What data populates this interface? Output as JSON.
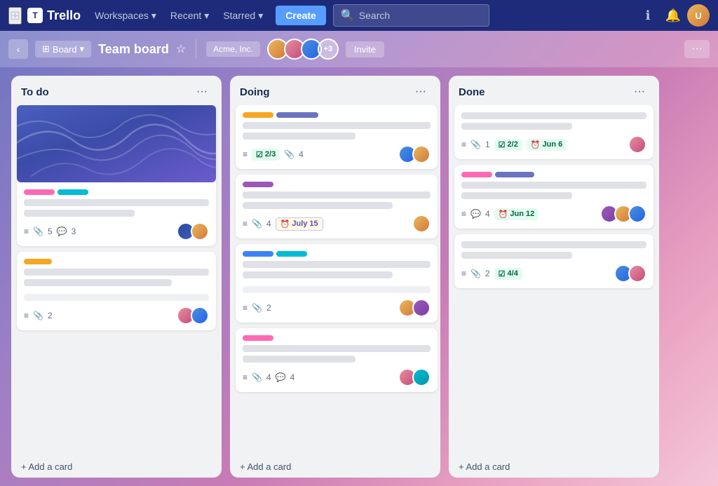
{
  "app": {
    "name": "Trello",
    "logo_char": "T"
  },
  "topnav": {
    "workspaces": "Workspaces",
    "recent": "Recent",
    "starred": "Starred",
    "create": "Create",
    "search_placeholder": "Search",
    "info_icon": "ℹ",
    "bell_icon": "🔔"
  },
  "board_header": {
    "view_label": "Board",
    "title": "Team board",
    "workspace": "Acme, Inc.",
    "extra_members": "+3",
    "invite": "Invite",
    "more": "···",
    "sidebar_arrow": "‹"
  },
  "columns": [
    {
      "id": "todo",
      "title": "To do",
      "cards": [
        {
          "id": "c1",
          "has_cover": true,
          "labels": [
            "#FF69B4",
            "#00BCD4"
          ],
          "title_lines": [
            "full",
            "short"
          ],
          "meta": {
            "list": true,
            "clips": "5",
            "comments": "3"
          },
          "avatars": [
            "#4A90D9",
            "#E8B95A"
          ]
        },
        {
          "id": "c2",
          "has_cover": false,
          "labels": [
            "#F5A623"
          ],
          "title_lines": [
            "full",
            "med"
          ],
          "meta": {
            "list": true,
            "clips": "2"
          },
          "avatars": [
            "#E88DA0",
            "#4A90D9"
          ]
        }
      ],
      "add_label": "+ Add a card"
    },
    {
      "id": "doing",
      "title": "Doing",
      "cards": [
        {
          "id": "d1",
          "has_cover": false,
          "labels": [
            "#F5A623",
            "#6B73C1"
          ],
          "title_lines": [
            "full",
            "short"
          ],
          "meta": {
            "list": true,
            "checks": "2/3",
            "clips": "4"
          },
          "avatars": [
            "#4A90D9",
            "#E8B95A"
          ]
        },
        {
          "id": "d2",
          "has_cover": false,
          "labels": [
            "#9B59B6"
          ],
          "title_lines": [
            "full",
            "med"
          ],
          "meta": {
            "list": true,
            "clips": "4",
            "date": "July 15"
          },
          "avatars": [
            "#E8B95A"
          ]
        },
        {
          "id": "d3",
          "has_cover": false,
          "labels": [
            "#3B82F6",
            "#00BCD4"
          ],
          "title_lines": [
            "full",
            "med"
          ],
          "meta": {
            "list": true,
            "clips": "2"
          },
          "avatars": [
            "#E8B95A",
            "#9B59B6"
          ]
        },
        {
          "id": "d4",
          "has_cover": false,
          "labels": [
            "#FF69B4"
          ],
          "title_lines": [
            "full",
            "short"
          ],
          "meta": {
            "list": true,
            "clips": "4",
            "comments": "4"
          },
          "avatars": [
            "#E88DA0",
            "#00BCD4"
          ]
        }
      ],
      "add_label": "+ Add a card"
    },
    {
      "id": "done",
      "title": "Done",
      "cards": [
        {
          "id": "dn1",
          "has_cover": false,
          "labels": [],
          "title_lines": [
            "full",
            "short"
          ],
          "meta": {
            "list": true,
            "clips": "1",
            "checks_badge": "2/2",
            "date": "Jun 6"
          },
          "avatars": [
            "#E88DA0"
          ]
        },
        {
          "id": "dn2",
          "has_cover": false,
          "labels": [
            "#FF69B4",
            "#6B73C1"
          ],
          "title_lines": [
            "full",
            "short"
          ],
          "meta": {
            "list": true,
            "comments": "4",
            "date": "Jun 12"
          },
          "avatars": [
            "#9B59B6",
            "#E8B95A",
            "#4A90D9"
          ]
        },
        {
          "id": "dn3",
          "has_cover": false,
          "labels": [],
          "title_lines": [
            "full",
            "short"
          ],
          "meta": {
            "list": true,
            "clips": "2",
            "checks_badge": "4/4"
          },
          "avatars": [
            "#4A90D9",
            "#E88DA0"
          ]
        }
      ],
      "add_label": "+ Add a card"
    }
  ]
}
